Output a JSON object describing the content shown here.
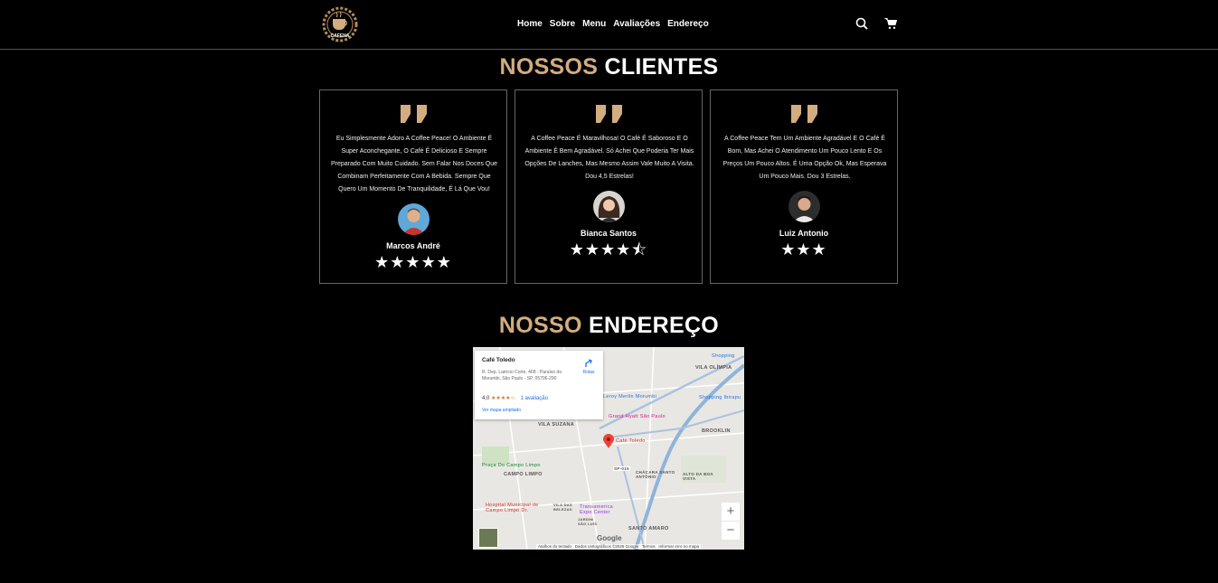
{
  "header": {
    "logo_text": "CAFENA",
    "nav": [
      "Home",
      "Sobre",
      "Menu",
      "Avaliações",
      "Endereço"
    ],
    "icons": [
      "search-icon",
      "cart-icon"
    ]
  },
  "clients_section": {
    "title_accent": "NOSSOS",
    "title_rest": "CLIENTES",
    "reviews": [
      {
        "text": "Eu Simplesmente Adoro A Coffee Peace! O Ambiente É Super Aconchegante, O Café É Delicioso E Sempre Preparado Com Muito Cuidado. Sem Falar Nos Doces Que Combinam Perfeitamente Com A Bebida. Sempre Que Quero Um Momento De Tranquilidade, É Lá Que Vou!",
        "name": "Marcos André",
        "stars": "★★★★★",
        "rating": 5
      },
      {
        "text": "A Coffee Peace É Maravilhosa! O Café É Saboroso E O Ambiente É Bem Agradável. Só Achei Que Poderia Ter Mais Opções De Lanches, Mas Mesmo Assim Vale Muito A Visita. Dou 4,5 Estrelas!",
        "name": "Bianca Santos",
        "stars": "★★★★⯪",
        "rating": 4.5
      },
      {
        "text": "A Coffee Peace Tem Um Ambiente Agradável E O Café É Bom, Mas Achei O Atendimento Um Pouco Lento E Os Preços Um Pouco Altos. É Uma Opção Ok, Mas Esperava Um Pouco Mais. Dou 3 Estrelas.",
        "name": "Luiz Antonio",
        "stars": "★★★",
        "rating": 3
      }
    ]
  },
  "address_section": {
    "title_accent": "NOSSO",
    "title_rest": "ENDEREÇO",
    "map": {
      "place_name": "Café Toledo",
      "address": "R. Dep. Laércio Corte, 468 - Paraíso do Morumbi, São Paulo - SP, 05706-290",
      "rating": "4,0",
      "rating_stars": "★★★★☆",
      "reviews_link": "1 avaliação",
      "route_label": "Rotas",
      "larger_map_link": "Ver mapa ampliado",
      "marker_label": "Café Toledo",
      "labels": {
        "vila_olimpia": "VILA OLÍMPIA",
        "shopping": "Shopping",
        "leroy": "Leroy Merlin Morumbi",
        "shopping_ibira": "Shopping Ibirapu",
        "grand_hyatt": "Grand Hyatt São Paulo",
        "vila_suzana": "VILA SUZANA",
        "brooklin": "BROOKLIN",
        "praca": "Praça Do Campo Limpo",
        "campo_limpo": "CAMPO LIMPO",
        "chacara": "CHÁCARA SANTO ANTÔNIO",
        "alto_boa_vista": "ALTO DA BOA VISTA",
        "hospital": "Hospital Municipal de Campo Limpo Dr.",
        "vila_das_belezas": "VILA DAS BELEZAS",
        "jardim_sao_luis": "JARDIM SÃO LUÍS",
        "transamerica": "Transamerica Expo Center",
        "santo_amaro": "SANTO AMARO",
        "sp_road": "SP-015"
      },
      "footer": {
        "google": "Google",
        "shortcuts": "Atalhos do teclado",
        "copyright": "Dados cartográficos ©2025 Google",
        "terms": "Termos",
        "report": "Informar erro no mapa"
      },
      "zoom_in": "+",
      "zoom_out": "−"
    }
  },
  "colors": {
    "accent": "#d3ad7f",
    "background": "#000000",
    "border": "#666666"
  }
}
